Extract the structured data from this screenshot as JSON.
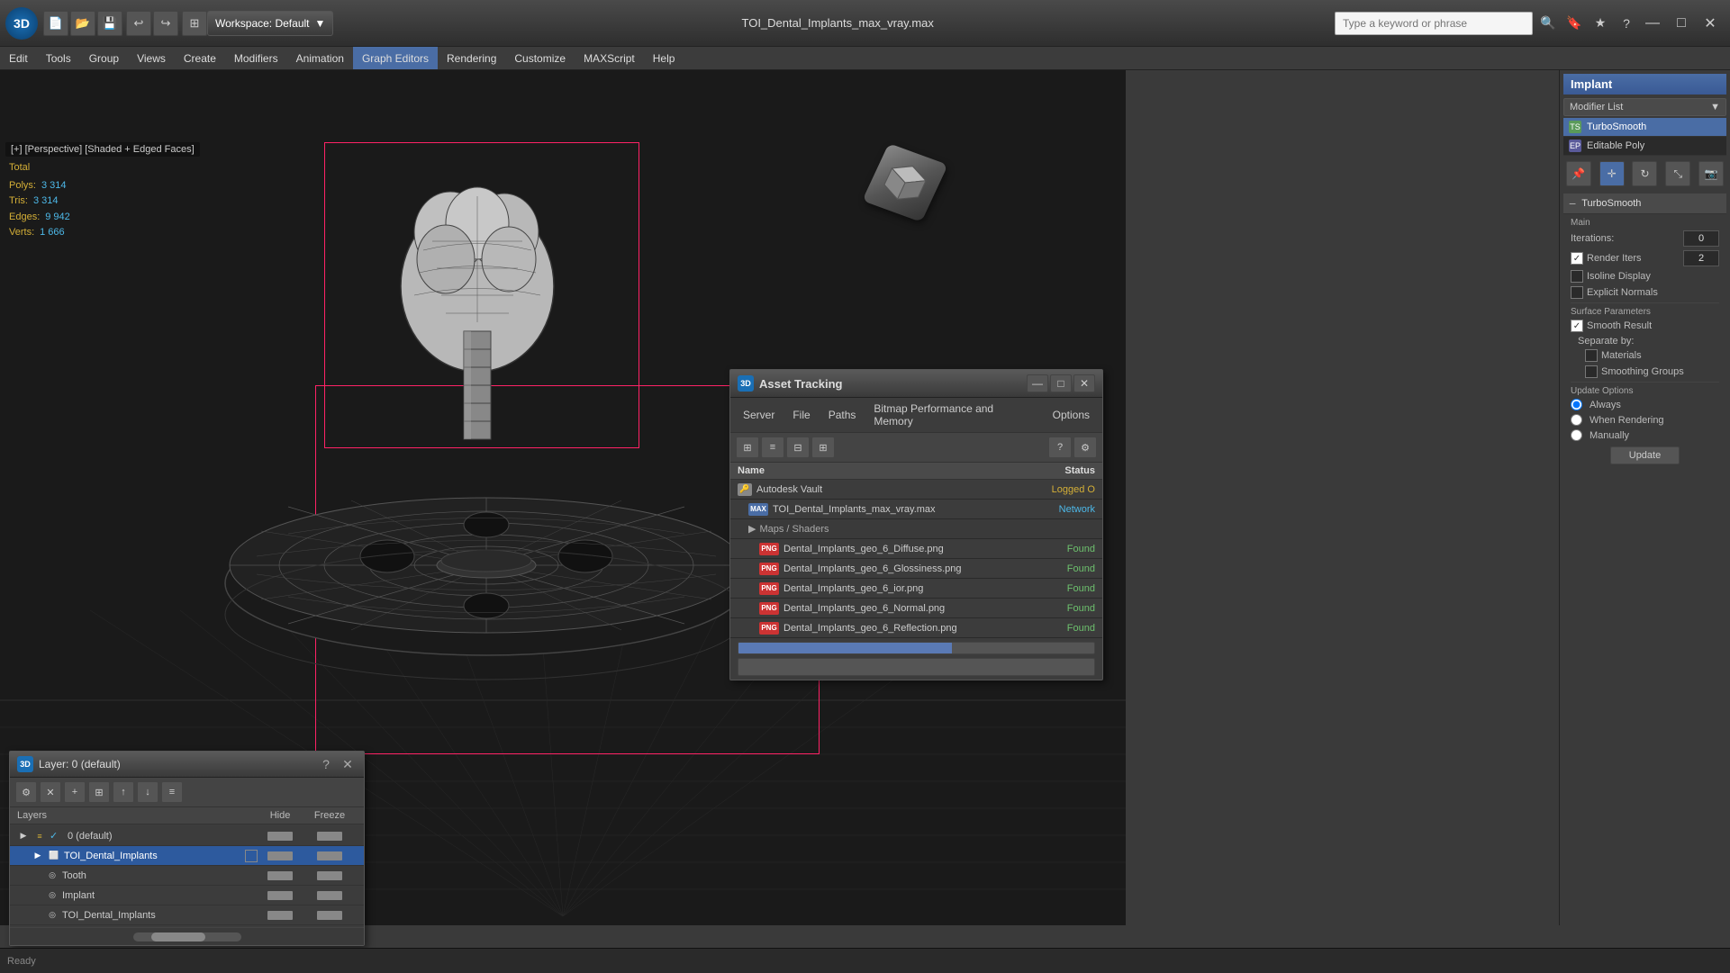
{
  "app": {
    "title": "TOI_Dental_Implants_max_vray.max",
    "workspace_label": "Workspace: Default",
    "logo_text": "3D"
  },
  "topbar": {
    "search_placeholder": "Type a keyword or phrase",
    "window_controls": [
      "minimize",
      "maximize",
      "close"
    ]
  },
  "menubar": {
    "items": [
      "Edit",
      "Tools",
      "Group",
      "Views",
      "Create",
      "Modifiers",
      "Animation",
      "Graph Editors",
      "Rendering",
      "Customize",
      "MAXScript",
      "Help"
    ]
  },
  "viewport": {
    "label": "[+] [Perspective] [Shaded + Edged Faces]",
    "stats": {
      "polys_label": "Polys:",
      "polys_value": "3 314",
      "tris_label": "Tris:",
      "tris_value": "3 314",
      "edges_label": "Edges:",
      "edges_value": "9 942",
      "verts_label": "Verts:",
      "verts_value": "1 666",
      "total_label": "Total"
    }
  },
  "right_panel": {
    "modifier_name": "Implant",
    "modifier_list_label": "Modifier List",
    "modifiers": [
      {
        "name": "TurboSmooth",
        "type": "ts"
      },
      {
        "name": "Editable Poly",
        "type": "ep"
      }
    ],
    "turbosmooth": {
      "title": "TurboSmooth",
      "section_main": "Main",
      "iterations_label": "Iterations:",
      "iterations_value": "0",
      "render_iters_label": "Render Iters",
      "render_iters_value": "2",
      "isoline_label": "Isoline Display",
      "explicit_label": "Explicit Normals",
      "surface_params_label": "Surface Parameters",
      "smooth_result_label": "Smooth Result",
      "separate_by_label": "Separate by:",
      "materials_label": "Materials",
      "smoothing_groups_label": "Smoothing Groups",
      "update_options_label": "Update Options",
      "always_label": "Always",
      "when_rendering_label": "When Rendering",
      "manually_label": "Manually",
      "update_btn": "Update"
    }
  },
  "layer_panel": {
    "title": "Layer: 0 (default)",
    "columns": {
      "name": "Layers",
      "hide": "Hide",
      "freeze": "Freeze"
    },
    "layers": [
      {
        "name": "0 (default)",
        "indent": 0,
        "type": "layer",
        "selected": false,
        "check": "✓"
      },
      {
        "name": "TOI_Dental_Implants",
        "indent": 1,
        "type": "object",
        "selected": true,
        "check": ""
      },
      {
        "name": "Tooth",
        "indent": 2,
        "type": "shape",
        "selected": false,
        "check": ""
      },
      {
        "name": "Implant",
        "indent": 2,
        "type": "shape",
        "selected": false,
        "check": ""
      },
      {
        "name": "TOI_Dental_Implants",
        "indent": 2,
        "type": "shape",
        "selected": false,
        "check": ""
      }
    ]
  },
  "asset_panel": {
    "title": "Asset Tracking",
    "menus": [
      "Server",
      "File",
      "Paths",
      "Bitmap Performance and Memory",
      "Options"
    ],
    "columns": {
      "name": "Name",
      "status": "Status"
    },
    "rows": [
      {
        "name": "Autodesk Vault",
        "status": "Logged O",
        "status_class": "status-logged",
        "type": "vault",
        "indent": 0
      },
      {
        "name": "TOI_Dental_Implants_max_vray.max",
        "status": "Network",
        "status_class": "status-network",
        "type": "max",
        "indent": 1
      },
      {
        "name": "Maps / Shaders",
        "status": "",
        "status_class": "",
        "type": "group",
        "indent": 1
      },
      {
        "name": "Dental_Implants_geo_6_Diffuse.png",
        "status": "Found",
        "status_class": "status-found",
        "type": "png",
        "indent": 2
      },
      {
        "name": "Dental_Implants_geo_6_Glossiness.png",
        "status": "Found",
        "status_class": "status-found",
        "type": "png",
        "indent": 2
      },
      {
        "name": "Dental_Implants_geo_6_ior.png",
        "status": "Found",
        "status_class": "status-found",
        "type": "png",
        "indent": 2
      },
      {
        "name": "Dental_Implants_geo_6_Normal.png",
        "status": "Found",
        "status_class": "status-found",
        "type": "png",
        "indent": 2
      },
      {
        "name": "Dental_Implants_geo_6_Reflection.png",
        "status": "Found",
        "status_class": "status-found",
        "type": "png",
        "indent": 2
      }
    ]
  },
  "icons": {
    "star": "★",
    "gear": "⚙",
    "search": "🔍",
    "close": "✕",
    "minimize": "—",
    "maximize": "□",
    "expand": "▼",
    "collapse": "▲",
    "arrow_left": "◀",
    "arrow_right": "▶",
    "checkmark": "✓",
    "plus": "+",
    "minus": "−",
    "folder": "📁",
    "file": "📄",
    "chain": "⛓",
    "grid": "⊞",
    "pin": "📌",
    "question": "?",
    "anchor": "⚓",
    "hammer": "🔨",
    "wrench": "🔧",
    "light": "💡",
    "camera": "📷",
    "layers": "≡",
    "link": "🔗",
    "help": "?",
    "lock": "🔒",
    "refresh": "↻",
    "up_arrow": "↑",
    "down_arrow": "↓",
    "undo": "↩",
    "redo": "↪",
    "save": "💾",
    "open": "📂",
    "new": "📄",
    "magnet": "⊕",
    "eye": "👁",
    "pen": "✏",
    "select": "↖",
    "move": "✛",
    "rotate": "↻",
    "scale": "⤡",
    "render": "▷",
    "material": "◆"
  },
  "colors": {
    "accent_blue": "#4a6da5",
    "accent_yellow": "#d4af37",
    "accent_cyan": "#4db8e8",
    "selection_pink": "#ff2266",
    "bg_dark": "#1a1a1a",
    "bg_mid": "#3c3c3c",
    "bg_light": "#4a4a4a",
    "status_found": "#6dc06d",
    "status_network": "#4db8e8"
  }
}
